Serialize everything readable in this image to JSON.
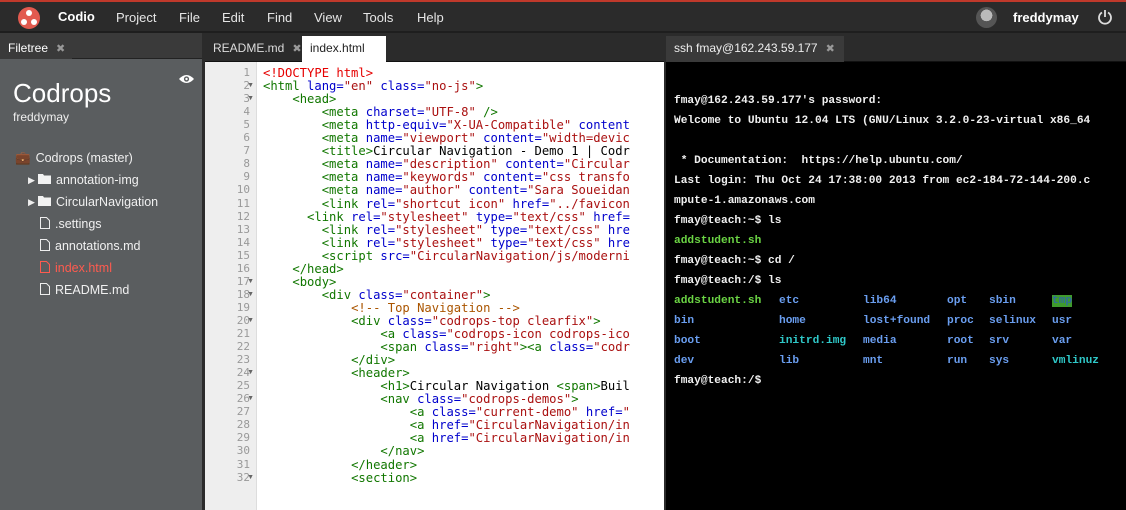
{
  "app": {
    "brand": "Codio"
  },
  "menu": [
    "Project",
    "File",
    "Edit",
    "Find",
    "View",
    "Tools",
    "Help"
  ],
  "user": {
    "name": "freddymay"
  },
  "filetree": {
    "tab_label": "Filetree",
    "project_title": "Codrops",
    "project_user": "freddymay",
    "root": "Codrops (master)",
    "items": [
      {
        "label": "annotation-img",
        "type": "folder"
      },
      {
        "label": "CircularNavigation",
        "type": "folder"
      },
      {
        "label": ".settings",
        "type": "file"
      },
      {
        "label": "annotations.md",
        "type": "file"
      },
      {
        "label": "index.html",
        "type": "file",
        "active": true
      },
      {
        "label": "README.md",
        "type": "file"
      }
    ]
  },
  "editor": {
    "tabs": [
      {
        "label": "README.md"
      },
      {
        "label": "index.html",
        "active": true
      }
    ],
    "lines": [
      [
        [
          "d",
          "<!DOCTYPE html>"
        ]
      ],
      [
        [
          "t",
          "<html "
        ],
        [
          "a",
          "lang="
        ],
        [
          "s",
          "\"en\""
        ],
        [
          "t",
          " "
        ],
        [
          "a",
          "class="
        ],
        [
          "s",
          "\"no-js\""
        ],
        [
          "t",
          ">"
        ]
      ],
      [
        [
          "",
          "    "
        ],
        [
          "t",
          "<head>"
        ]
      ],
      [
        [
          "",
          "        "
        ],
        [
          "t",
          "<meta "
        ],
        [
          "a",
          "charset="
        ],
        [
          "s",
          "\"UTF-8\""
        ],
        [
          "t",
          " />"
        ]
      ],
      [
        [
          "",
          "        "
        ],
        [
          "t",
          "<meta "
        ],
        [
          "a",
          "http-equiv="
        ],
        [
          "s",
          "\"X-UA-Compatible\""
        ],
        [
          "t",
          " "
        ],
        [
          "a",
          "content"
        ]
      ],
      [
        [
          "",
          "        "
        ],
        [
          "t",
          "<meta "
        ],
        [
          "a",
          "name="
        ],
        [
          "s",
          "\"viewport\""
        ],
        [
          "t",
          " "
        ],
        [
          "a",
          "content="
        ],
        [
          "s",
          "\"width=devic"
        ]
      ],
      [
        [
          "",
          "        "
        ],
        [
          "t",
          "<title>"
        ],
        [
          "",
          "Circular Navigation - Demo 1 | Codr"
        ]
      ],
      [
        [
          "",
          "        "
        ],
        [
          "t",
          "<meta "
        ],
        [
          "a",
          "name="
        ],
        [
          "s",
          "\"description\""
        ],
        [
          "t",
          " "
        ],
        [
          "a",
          "content="
        ],
        [
          "s",
          "\"Circular"
        ]
      ],
      [
        [
          "",
          "        "
        ],
        [
          "t",
          "<meta "
        ],
        [
          "a",
          "name="
        ],
        [
          "s",
          "\"keywords\""
        ],
        [
          "t",
          " "
        ],
        [
          "a",
          "content="
        ],
        [
          "s",
          "\"css transfo"
        ]
      ],
      [
        [
          "",
          "        "
        ],
        [
          "t",
          "<meta "
        ],
        [
          "a",
          "name="
        ],
        [
          "s",
          "\"author\""
        ],
        [
          "t",
          " "
        ],
        [
          "a",
          "content="
        ],
        [
          "s",
          "\"Sara Soueidan"
        ]
      ],
      [
        [
          "",
          "        "
        ],
        [
          "t",
          "<link "
        ],
        [
          "a",
          "rel="
        ],
        [
          "s",
          "\"shortcut icon\""
        ],
        [
          "t",
          " "
        ],
        [
          "a",
          "href="
        ],
        [
          "s",
          "\"../favicon"
        ]
      ],
      [
        [
          "",
          "      "
        ],
        [
          "t",
          "<link "
        ],
        [
          "a",
          "rel="
        ],
        [
          "s",
          "\"stylesheet\""
        ],
        [
          "t",
          " "
        ],
        [
          "a",
          "type="
        ],
        [
          "s",
          "\"text/css\""
        ],
        [
          "t",
          " "
        ],
        [
          "a",
          "href="
        ]
      ],
      [
        [
          "",
          "        "
        ],
        [
          "t",
          "<link "
        ],
        [
          "a",
          "rel="
        ],
        [
          "s",
          "\"stylesheet\""
        ],
        [
          "t",
          " "
        ],
        [
          "a",
          "type="
        ],
        [
          "s",
          "\"text/css\""
        ],
        [
          "t",
          " "
        ],
        [
          "a",
          "hre"
        ]
      ],
      [
        [
          "",
          "        "
        ],
        [
          "t",
          "<link "
        ],
        [
          "a",
          "rel="
        ],
        [
          "s",
          "\"stylesheet\""
        ],
        [
          "t",
          " "
        ],
        [
          "a",
          "type="
        ],
        [
          "s",
          "\"text/css\""
        ],
        [
          "t",
          " "
        ],
        [
          "a",
          "hre"
        ]
      ],
      [
        [
          "",
          "        "
        ],
        [
          "t",
          "<script "
        ],
        [
          "a",
          "src="
        ],
        [
          "s",
          "\"CircularNavigation/js/moderni"
        ]
      ],
      [
        [
          "",
          "    "
        ],
        [
          "t",
          "</head>"
        ]
      ],
      [
        [
          "",
          "    "
        ],
        [
          "t",
          "<body>"
        ]
      ],
      [
        [
          "",
          "        "
        ],
        [
          "t",
          "<div "
        ],
        [
          "a",
          "class="
        ],
        [
          "s",
          "\"container\""
        ],
        [
          "t",
          ">"
        ]
      ],
      [
        [
          "",
          "            "
        ],
        [
          "c",
          "<!-- Top Navigation -->"
        ]
      ],
      [
        [
          "",
          "            "
        ],
        [
          "t",
          "<div "
        ],
        [
          "a",
          "class="
        ],
        [
          "s",
          "\"codrops-top clearfix\""
        ],
        [
          "t",
          ">"
        ]
      ],
      [
        [
          "",
          "                "
        ],
        [
          "t",
          "<a "
        ],
        [
          "a",
          "class="
        ],
        [
          "s",
          "\"codrops-icon codrops-ico"
        ]
      ],
      [
        [
          "",
          "                "
        ],
        [
          "t",
          "<span "
        ],
        [
          "a",
          "class="
        ],
        [
          "s",
          "\"right\""
        ],
        [
          "t",
          "><a "
        ],
        [
          "a",
          "class="
        ],
        [
          "s",
          "\"codr"
        ]
      ],
      [
        [
          "",
          "            "
        ],
        [
          "t",
          "</div>"
        ]
      ],
      [
        [
          "",
          "            "
        ],
        [
          "t",
          "<header>"
        ]
      ],
      [
        [
          "",
          "                "
        ],
        [
          "t",
          "<h1>"
        ],
        [
          "",
          "Circular Navigation "
        ],
        [
          "t",
          "<span>"
        ],
        [
          "",
          "Buil"
        ]
      ],
      [
        [
          "",
          "                "
        ],
        [
          "t",
          "<nav "
        ],
        [
          "a",
          "class="
        ],
        [
          "s",
          "\"codrops-demos\""
        ],
        [
          "t",
          ">"
        ]
      ],
      [
        [
          "",
          "                    "
        ],
        [
          "t",
          "<a "
        ],
        [
          "a",
          "class="
        ],
        [
          "s",
          "\"current-demo\""
        ],
        [
          "t",
          " "
        ],
        [
          "a",
          "href="
        ],
        [
          "s",
          "\""
        ]
      ],
      [
        [
          "",
          "                    "
        ],
        [
          "t",
          "<a "
        ],
        [
          "a",
          "href="
        ],
        [
          "s",
          "\"CircularNavigation/in"
        ]
      ],
      [
        [
          "",
          "                    "
        ],
        [
          "t",
          "<a "
        ],
        [
          "a",
          "href="
        ],
        [
          "s",
          "\"CircularNavigation/in"
        ]
      ],
      [
        [
          "",
          "                "
        ],
        [
          "t",
          "</nav>"
        ]
      ],
      [
        [
          "",
          "            "
        ],
        [
          "t",
          "</header>"
        ]
      ],
      [
        [
          "",
          "            "
        ],
        [
          "t",
          "<section>"
        ]
      ]
    ],
    "fold_lines": [
      2,
      3,
      17,
      18,
      20,
      24,
      26,
      32
    ]
  },
  "terminal": {
    "tab_label": "ssh fmay@162.243.59.177",
    "lines": [
      "fmay@162.243.59.177's password:",
      "Welcome to Ubuntu 12.04 LTS (GNU/Linux 3.2.0-23-virtual x86_64",
      "",
      " * Documentation:  https://help.ubuntu.com/",
      "Last login: Thu Oct 24 17:38:00 2013 from ec2-184-72-144-200.c",
      "mpute-1.amazonaws.com",
      "fmay@teach:~$ ls",
      "",
      "fmay@teach:~$ cd /",
      "fmay@teach:/$ ls"
    ],
    "first_ls": "addstudent.sh",
    "root_listing": [
      [
        {
          "t": "addstudent.sh",
          "c": "exec"
        },
        {
          "t": "etc",
          "c": "dir"
        },
        {
          "t": "lib64",
          "c": "dir"
        },
        {
          "t": "opt",
          "c": "dir"
        },
        {
          "t": "sbin",
          "c": "dir"
        },
        {
          "t": "tmp",
          "c": "tmp"
        }
      ],
      [
        {
          "t": "bin",
          "c": "dir"
        },
        {
          "t": "home",
          "c": "dir"
        },
        {
          "t": "lost+found",
          "c": "dir"
        },
        {
          "t": "proc",
          "c": "dir"
        },
        {
          "t": "selinux",
          "c": "dir"
        },
        {
          "t": "usr",
          "c": "dir"
        }
      ],
      [
        {
          "t": "boot",
          "c": "dir"
        },
        {
          "t": "initrd.img",
          "c": "cyan"
        },
        {
          "t": "media",
          "c": "dir"
        },
        {
          "t": "root",
          "c": "dir"
        },
        {
          "t": "srv",
          "c": "dir"
        },
        {
          "t": "var",
          "c": "dir"
        }
      ],
      [
        {
          "t": "dev",
          "c": "dir"
        },
        {
          "t": "lib",
          "c": "dir"
        },
        {
          "t": "mnt",
          "c": "dir"
        },
        {
          "t": "run",
          "c": "dir"
        },
        {
          "t": "sys",
          "c": "dir"
        },
        {
          "t": "vmlinuz",
          "c": "cyan"
        }
      ]
    ],
    "final_prompt": "fmay@teach:/$"
  }
}
